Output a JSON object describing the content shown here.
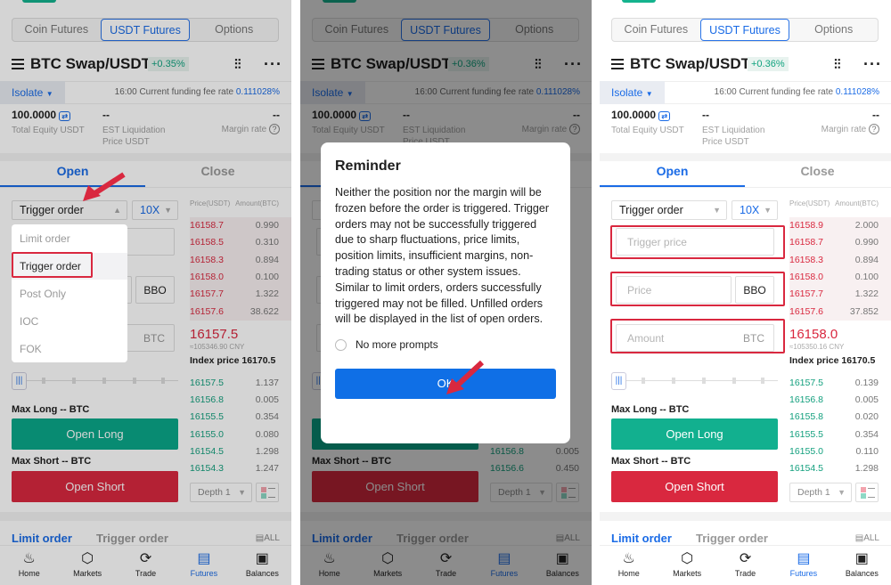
{
  "colors": {
    "accent": "#1a6be6",
    "long": "#13a07e",
    "short": "#d9283f",
    "highlight": "#d9283f"
  },
  "panels": [
    {
      "tabs": [
        "Coin Futures",
        "USDT Futures",
        "Options"
      ],
      "pair": "BTC Swap/USDT",
      "change": "+0.35%",
      "margin_mode": "Isolate",
      "funding_label": "16:00 Current funding fee rate",
      "funding_rate": "0.111028%",
      "equity": "100.0000",
      "equity_label": "Total Equity USDT",
      "liq_value": "--",
      "liq_label1": "EST Liquidation",
      "liq_label2": "Price USDT",
      "margin_rate_value": "--",
      "margin_rate_label": "Margin rate",
      "open_tab": "Open",
      "close_tab": "Close",
      "order_type": "Trigger order",
      "leverage": "10X",
      "inputs": {
        "bbo": "BBO",
        "amount_unit": "BTC"
      },
      "max_long": "Max Long -- BTC",
      "open_long": "Open Long",
      "max_short": "Max Short -- BTC",
      "open_short": "Open Short",
      "book": {
        "header_price": "Price(USDT)",
        "header_amount": "Amount(BTC)",
        "asks": [
          [
            "16158.7",
            "0.990"
          ],
          [
            "16158.5",
            "0.310"
          ],
          [
            "16158.3",
            "0.894"
          ],
          [
            "16158.0",
            "0.100"
          ],
          [
            "16157.7",
            "1.322"
          ],
          [
            "16157.6",
            "38.622"
          ]
        ],
        "last_price": "16157.5",
        "cny": "≈105346.90 CNY",
        "index_price": "Index price 16170.5",
        "bids": [
          [
            "16157.5",
            "1.137"
          ],
          [
            "16156.8",
            "0.005"
          ],
          [
            "16155.5",
            "0.354"
          ],
          [
            "16155.0",
            "0.080"
          ],
          [
            "16154.5",
            "1.298"
          ],
          [
            "16154.3",
            "1.247"
          ]
        ],
        "depth": "Depth 1"
      },
      "bottom": {
        "limit": "Limit order",
        "trigger": "Trigger order",
        "all": "ALL"
      },
      "nav": [
        {
          "label": "Home",
          "icon": "flame-icon"
        },
        {
          "label": "Markets",
          "icon": "compass-icon"
        },
        {
          "label": "Trade",
          "icon": "exchange-icon"
        },
        {
          "label": "Futures",
          "icon": "futures-icon",
          "active": true
        },
        {
          "label": "Balances",
          "icon": "wallet-icon"
        }
      ],
      "dropdown": {
        "options": [
          "Limit order",
          "Trigger order",
          "Post Only",
          "IOC",
          "FOK"
        ],
        "selected": "Trigger order"
      }
    },
    {
      "tabs": [
        "Coin Futures",
        "USDT Futures",
        "Options"
      ],
      "pair": "BTC Swap/USDT",
      "change": "+0.36%",
      "margin_mode": "Isolate",
      "funding_label": "16:00 Current funding fee rate",
      "funding_rate": "0.111028%",
      "equity": "100.0000",
      "equity_label": "Total Equity USDT",
      "liq_value": "--",
      "liq_label1": "EST Liquidation",
      "liq_label2": "Price USDT",
      "margin_rate_value": "--",
      "margin_rate_label": "Margin rate",
      "open_tab": "Open",
      "close_tab": "Close",
      "inputs": {},
      "max_short": "Max Short -- BTC",
      "open_short": "Open Short",
      "book": {
        "bids": [
          [
            "16156.8",
            "0.005"
          ],
          [
            "16156.6",
            "0.450"
          ]
        ],
        "depth": "Depth 1"
      },
      "bottom": {
        "limit": "Limit order",
        "trigger": "Trigger order",
        "all": "ALL"
      },
      "nav": [
        {
          "label": "Home",
          "icon": "flame-icon"
        },
        {
          "label": "Markets",
          "icon": "compass-icon"
        },
        {
          "label": "Trade",
          "icon": "exchange-icon"
        },
        {
          "label": "Futures",
          "icon": "futures-icon",
          "active": true
        },
        {
          "label": "Balances",
          "icon": "wallet-icon"
        }
      ],
      "modal": {
        "title": "Reminder",
        "body": "Neither the position nor the margin will be frozen before the order is triggered. Trigger orders may not be successfully triggered due to sharp fluctuations, price limits, position limits, insufficient margins, non-trading status or other system issues. Similar to limit orders, orders successfully triggered may not be filled. Unfilled orders will be displayed in the list of open orders.",
        "checkbox": "No more prompts",
        "ok": "OK"
      }
    },
    {
      "tabs": [
        "Coin Futures",
        "USDT Futures",
        "Options"
      ],
      "pair": "BTC Swap/USDT",
      "change": "+0.36%",
      "margin_mode": "Isolate",
      "funding_label": "16:00 Current funding fee rate",
      "funding_rate": "0.111028%",
      "equity": "100.0000",
      "equity_label": "Total Equity USDT",
      "liq_value": "--",
      "liq_label1": "EST Liquidation",
      "liq_label2": "Price USDT",
      "margin_rate_value": "--",
      "margin_rate_label": "Margin rate",
      "open_tab": "Open",
      "close_tab": "Close",
      "order_type": "Trigger order",
      "leverage": "10X",
      "inputs": {
        "trigger_placeholder": "Trigger price",
        "price_placeholder": "Price",
        "bbo": "BBO",
        "amount_placeholder": "Amount",
        "amount_unit": "BTC"
      },
      "max_long": "Max Long -- BTC",
      "open_long": "Open Long",
      "max_short": "Max Short -- BTC",
      "open_short": "Open Short",
      "book": {
        "header_price": "Price(USDT)",
        "header_amount": "Amount(BTC)",
        "asks": [
          [
            "16158.9",
            "2.000"
          ],
          [
            "16158.7",
            "0.990"
          ],
          [
            "16158.3",
            "0.894"
          ],
          [
            "16158.0",
            "0.100"
          ],
          [
            "16157.7",
            "1.322"
          ],
          [
            "16157.6",
            "37.852"
          ]
        ],
        "last_price": "16158.0",
        "cny": "≈105350.16 CNY",
        "index_price": "Index price 16170.5",
        "bids": [
          [
            "16157.5",
            "0.139"
          ],
          [
            "16156.8",
            "0.005"
          ],
          [
            "16155.8",
            "0.020"
          ],
          [
            "16155.5",
            "0.354"
          ],
          [
            "16155.0",
            "0.110"
          ],
          [
            "16154.5",
            "1.298"
          ]
        ],
        "depth": "Depth 1"
      },
      "bottom": {
        "limit": "Limit order",
        "trigger": "Trigger order",
        "all": "ALL"
      },
      "nav": [
        {
          "label": "Home",
          "icon": "flame-icon"
        },
        {
          "label": "Markets",
          "icon": "compass-icon"
        },
        {
          "label": "Trade",
          "icon": "exchange-icon"
        },
        {
          "label": "Futures",
          "icon": "futures-icon",
          "active": true
        },
        {
          "label": "Balances",
          "icon": "wallet-icon"
        }
      ]
    }
  ]
}
